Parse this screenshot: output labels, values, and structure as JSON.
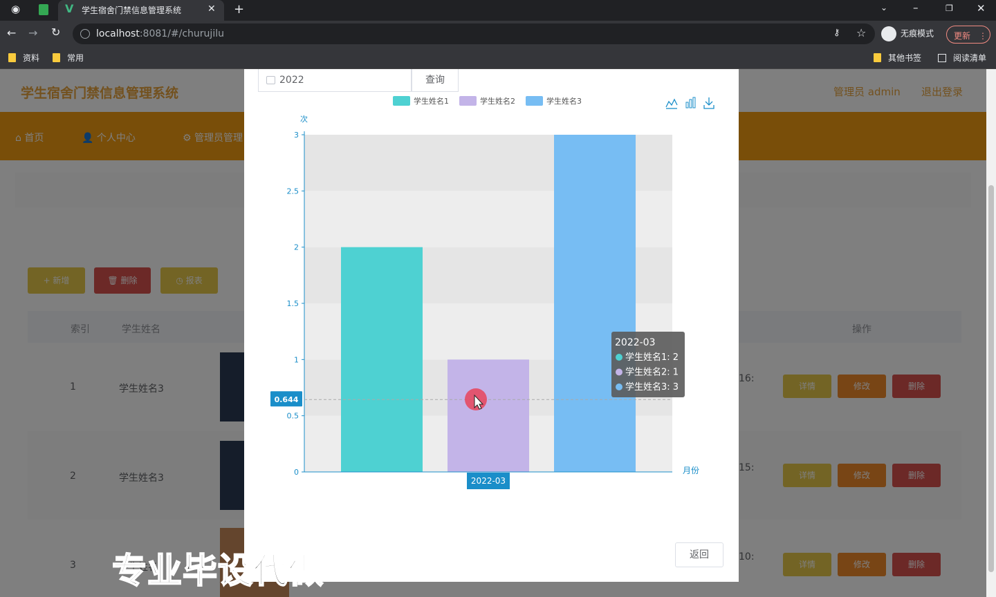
{
  "browser": {
    "tab_title": "学生宿舍门禁信息管理系统",
    "url_host": "localhost",
    "url_rest": ":8081/#/churujilu",
    "incognito_label": "无痕模式",
    "update_label": "更新",
    "bookmarks": [
      "资料",
      "常用"
    ],
    "bookmarks_right": [
      "其他书签",
      "阅读清单"
    ]
  },
  "app": {
    "title": "学生宿舍门禁信息管理系统",
    "user": "管理员 admin",
    "logout": "退出登录",
    "nav": [
      "首页",
      "个人中心",
      "管理员管理"
    ],
    "actions": {
      "add": "+ 新增",
      "delete": "删除",
      "report": "报表"
    },
    "table_headers": {
      "index": "索引",
      "name": "学生姓名",
      "ops": "操作"
    },
    "rows": [
      {
        "index": "1",
        "name": "学生姓名3",
        "time_tail": "16:"
      },
      {
        "index": "2",
        "name": "学生姓名3",
        "time_tail": "15:"
      },
      {
        "index": "3",
        "name": "学生姓名2",
        "time_tail": "10:"
      }
    ],
    "row_ops": {
      "detail": "详情",
      "edit": "修改",
      "delete": "删除"
    }
  },
  "dialog": {
    "year_value": "2022",
    "query_label": "查询",
    "return_label": "返回"
  },
  "chart_data": {
    "type": "bar",
    "categories": [
      "2022-03"
    ],
    "series": [
      {
        "name": "学生姓名1",
        "values": [
          2
        ],
        "color": "#4ed1d2"
      },
      {
        "name": "学生姓名2",
        "values": [
          1
        ],
        "color": "#c3b4e8"
      },
      {
        "name": "学生姓名3",
        "values": [
          3
        ],
        "color": "#77bdf3"
      }
    ],
    "ylabel": "次",
    "xlabel": "月份",
    "ylim": [
      0,
      3
    ],
    "yticks": [
      "0",
      "0.5",
      "1",
      "1.5",
      "2",
      "2.5",
      "3"
    ],
    "legend": "top",
    "axis_pointer_value": "0.644",
    "axis_pointer_category": "2022-03",
    "tooltip": {
      "title": "2022-03",
      "lines": [
        "学生姓名1: 2",
        "学生姓名2: 1",
        "学生姓名3: 3"
      ]
    }
  },
  "watermark": "专业毕设代做",
  "colors": {
    "accent": "#f39c12",
    "brand_text": "#e6a23c",
    "axis": "#1a8ec9"
  }
}
